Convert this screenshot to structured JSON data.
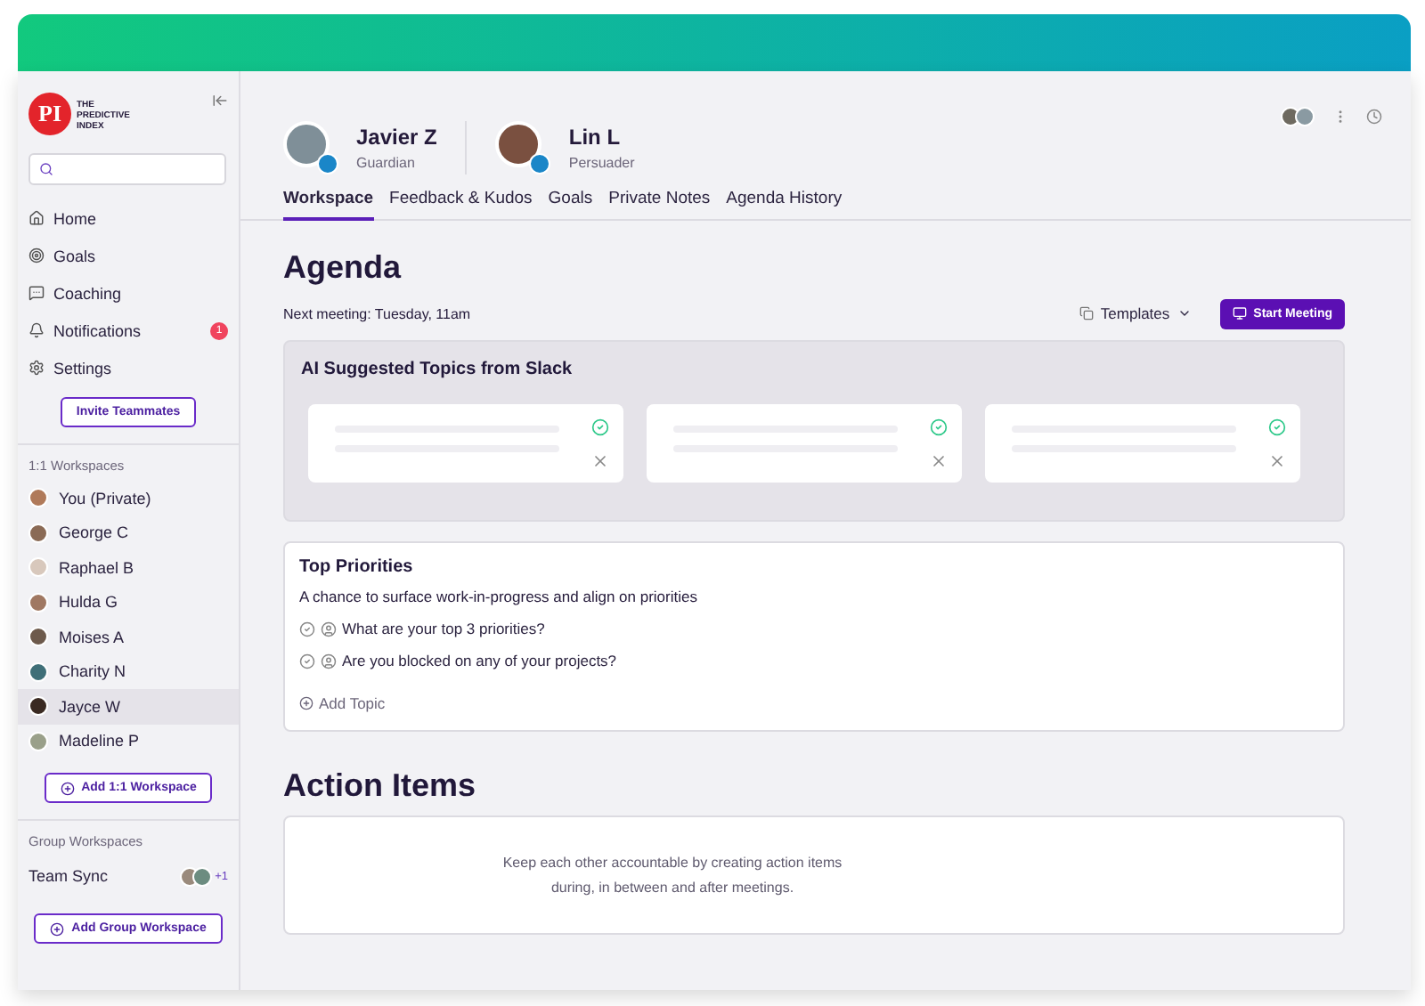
{
  "logo": {
    "mark": "PI",
    "wordmark": "THE PREDICTIVE INDEX"
  },
  "nav": [
    {
      "kind": "home",
      "label": "Home"
    },
    {
      "kind": "goals",
      "label": "Goals"
    },
    {
      "kind": "coaching",
      "label": "Coaching"
    },
    {
      "kind": "notifications",
      "label": "Notifications",
      "badge": "1"
    },
    {
      "kind": "settings",
      "label": "Settings"
    }
  ],
  "invite_button": "Invite Teammates",
  "workspaces": {
    "title": "1:1 Workspaces",
    "add_button": "Add 1:1 Workspace",
    "items": [
      {
        "name": "You (Private)",
        "selected": false,
        "color": "#b07a5a"
      },
      {
        "name": "George C",
        "selected": false,
        "color": "#8a6a55"
      },
      {
        "name": "Raphael B",
        "selected": false,
        "color": "#d8c8bc"
      },
      {
        "name": "Hulda G",
        "selected": false,
        "color": "#a07862"
      },
      {
        "name": "Moises A",
        "selected": false,
        "color": "#6d5a4c"
      },
      {
        "name": "Charity N",
        "selected": false,
        "color": "#3f6f78"
      },
      {
        "name": "Jayce W",
        "selected": true,
        "color": "#3a2a22"
      },
      {
        "name": "Madeline P",
        "selected": false,
        "color": "#9aa08a"
      }
    ]
  },
  "group_workspaces": {
    "title": "Group Workspaces",
    "add_button": "Add Group Workspace",
    "items": [
      {
        "name": "Team Sync",
        "extra": "+1"
      }
    ]
  },
  "participants": [
    {
      "name": "Javier Z",
      "profile": "Guardian"
    },
    {
      "name": "Lin L",
      "profile": "Persuader"
    }
  ],
  "tabs": [
    {
      "label": "Workspace",
      "selected": true
    },
    {
      "label": "Feedback & Kudos",
      "selected": false
    },
    {
      "label": "Goals",
      "selected": false
    },
    {
      "label": "Private Notes",
      "selected": false
    },
    {
      "label": "Agenda History",
      "selected": false
    }
  ],
  "agenda": {
    "title": "Agenda",
    "next_meeting": "Next meeting: Tuesday, 11am",
    "templates": "Templates",
    "start_button": "Start Meeting"
  },
  "ai_suggestions": {
    "title": "AI Suggested Topics from Slack",
    "cards": [
      {
        "kind": "loading"
      },
      {
        "kind": "loading"
      },
      {
        "kind": "loading"
      }
    ]
  },
  "top_priorities": {
    "title": "Top Priorities",
    "description": "A chance to surface work-in-progress and align on priorities",
    "topics": [
      {
        "text": "What are your top 3 priorities?",
        "checked": false
      },
      {
        "text": "Are you blocked on any of your projects?",
        "checked": false
      }
    ],
    "add_topic": "Add Topic"
  },
  "action_items": {
    "title": "Action Items",
    "empty_message": "Keep each other accountable by creating action items during, in between and after meetings."
  }
}
